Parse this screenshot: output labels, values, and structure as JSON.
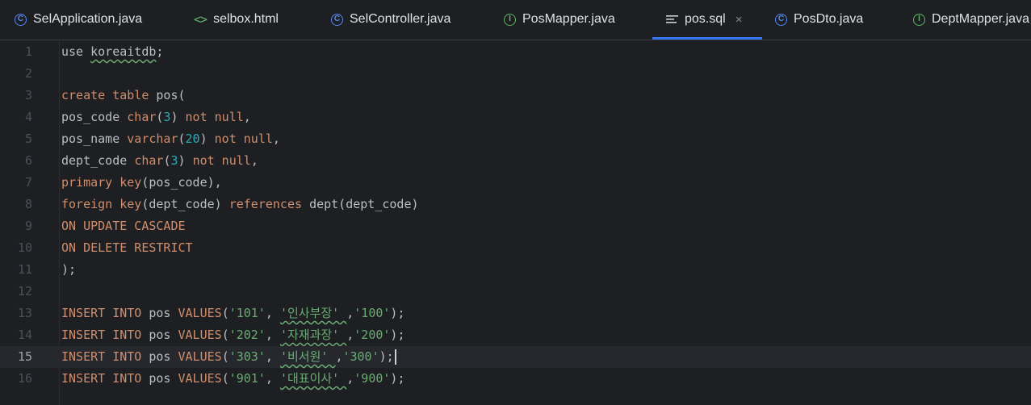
{
  "tabs": [
    {
      "label": "SelApplication.java",
      "icon": "java-class-icon",
      "active": false
    },
    {
      "label": "selbox.html",
      "icon": "html-file-icon",
      "active": false
    },
    {
      "label": "SelController.java",
      "icon": "java-class-icon",
      "active": false
    },
    {
      "label": "PosMapper.java",
      "icon": "java-interface-icon",
      "active": false
    },
    {
      "label": "pos.sql",
      "icon": "sql-file-icon",
      "active": true
    },
    {
      "label": "PosDto.java",
      "icon": "java-class-icon",
      "active": false
    },
    {
      "label": "DeptMapper.java",
      "icon": "java-interface-icon",
      "active": false
    }
  ],
  "close_glyph": "×",
  "colors": {
    "keyword": "#cf8e6d",
    "number": "#2aacb8",
    "string": "#6aab73",
    "text": "#bcbec4",
    "accent": "#3574f0",
    "background": "#1e1f22"
  },
  "editor": {
    "current_line": 15,
    "lines": [
      {
        "n": "1",
        "tokens": [
          {
            "t": "use ",
            "c": "plain"
          },
          {
            "t": "koreaitdb",
            "c": "plain"
          },
          {
            "t": ";",
            "c": "plain"
          }
        ]
      },
      {
        "n": "2",
        "tokens": []
      },
      {
        "n": "3",
        "tokens": [
          {
            "t": "create table ",
            "c": "kw"
          },
          {
            "t": "pos(",
            "c": "plain"
          }
        ]
      },
      {
        "n": "4",
        "tokens": [
          {
            "t": "pos_code ",
            "c": "plain"
          },
          {
            "t": "char",
            "c": "kw"
          },
          {
            "t": "(",
            "c": "plain"
          },
          {
            "t": "3",
            "c": "num"
          },
          {
            "t": ") ",
            "c": "plain"
          },
          {
            "t": "not null",
            "c": "kw"
          },
          {
            "t": ",",
            "c": "plain"
          }
        ]
      },
      {
        "n": "5",
        "tokens": [
          {
            "t": "pos_name ",
            "c": "plain"
          },
          {
            "t": "varchar",
            "c": "kw"
          },
          {
            "t": "(",
            "c": "plain"
          },
          {
            "t": "20",
            "c": "num"
          },
          {
            "t": ") ",
            "c": "plain"
          },
          {
            "t": "not null",
            "c": "kw"
          },
          {
            "t": ",",
            "c": "plain"
          }
        ]
      },
      {
        "n": "6",
        "tokens": [
          {
            "t": "dept_code ",
            "c": "plain"
          },
          {
            "t": "char",
            "c": "kw"
          },
          {
            "t": "(",
            "c": "plain"
          },
          {
            "t": "3",
            "c": "num"
          },
          {
            "t": ") ",
            "c": "plain"
          },
          {
            "t": "not null",
            "c": "kw"
          },
          {
            "t": ",",
            "c": "plain"
          }
        ]
      },
      {
        "n": "7",
        "tokens": [
          {
            "t": "primary key",
            "c": "kw"
          },
          {
            "t": "(pos_code),",
            "c": "plain"
          }
        ]
      },
      {
        "n": "8",
        "tokens": [
          {
            "t": "foreign key",
            "c": "kw"
          },
          {
            "t": "(dept_code) ",
            "c": "plain"
          },
          {
            "t": "references ",
            "c": "kw"
          },
          {
            "t": "dept(dept_code)",
            "c": "plain"
          }
        ]
      },
      {
        "n": "9",
        "tokens": [
          {
            "t": "ON UPDATE CASCADE",
            "c": "kw"
          }
        ]
      },
      {
        "n": "10",
        "tokens": [
          {
            "t": "ON DELETE RESTRICT",
            "c": "kw"
          }
        ]
      },
      {
        "n": "11",
        "tokens": [
          {
            "t": ");",
            "c": "plain"
          }
        ]
      },
      {
        "n": "12",
        "tokens": []
      },
      {
        "n": "13",
        "tokens": [
          {
            "t": "INSERT INTO ",
            "c": "kw"
          },
          {
            "t": "pos ",
            "c": "plain"
          },
          {
            "t": "VALUES",
            "c": "kw"
          },
          {
            "t": "(",
            "c": "plain"
          },
          {
            "t": "'101'",
            "c": "str"
          },
          {
            "t": ", ",
            "c": "plain"
          },
          {
            "t": "'인사부장' ",
            "c": "str"
          },
          {
            "t": ",",
            "c": "plain"
          },
          {
            "t": "'100'",
            "c": "str"
          },
          {
            "t": ");",
            "c": "plain"
          }
        ]
      },
      {
        "n": "14",
        "tokens": [
          {
            "t": "INSERT INTO ",
            "c": "kw"
          },
          {
            "t": "pos ",
            "c": "plain"
          },
          {
            "t": "VALUES",
            "c": "kw"
          },
          {
            "t": "(",
            "c": "plain"
          },
          {
            "t": "'202'",
            "c": "str"
          },
          {
            "t": ", ",
            "c": "plain"
          },
          {
            "t": "'자재과장' ",
            "c": "str"
          },
          {
            "t": ",",
            "c": "plain"
          },
          {
            "t": "'200'",
            "c": "str"
          },
          {
            "t": ");",
            "c": "plain"
          }
        ]
      },
      {
        "n": "15",
        "tokens": [
          {
            "t": "INSERT INTO ",
            "c": "kw"
          },
          {
            "t": "pos ",
            "c": "plain"
          },
          {
            "t": "VALUES",
            "c": "kw"
          },
          {
            "t": "(",
            "c": "plain"
          },
          {
            "t": "'303'",
            "c": "str"
          },
          {
            "t": ", ",
            "c": "plain"
          },
          {
            "t": "'비서원' ",
            "c": "str"
          },
          {
            "t": ",",
            "c": "plain"
          },
          {
            "t": "'300'",
            "c": "str"
          },
          {
            "t": ");",
            "c": "plain"
          }
        ]
      },
      {
        "n": "16",
        "tokens": [
          {
            "t": "INSERT INTO ",
            "c": "kw"
          },
          {
            "t": "pos ",
            "c": "plain"
          },
          {
            "t": "VALUES",
            "c": "kw"
          },
          {
            "t": "(",
            "c": "plain"
          },
          {
            "t": "'901'",
            "c": "str"
          },
          {
            "t": ", ",
            "c": "plain"
          },
          {
            "t": "'대표이사' ",
            "c": "str"
          },
          {
            "t": ",",
            "c": "plain"
          },
          {
            "t": "'900'",
            "c": "str"
          },
          {
            "t": ");",
            "c": "plain"
          }
        ]
      }
    ]
  }
}
